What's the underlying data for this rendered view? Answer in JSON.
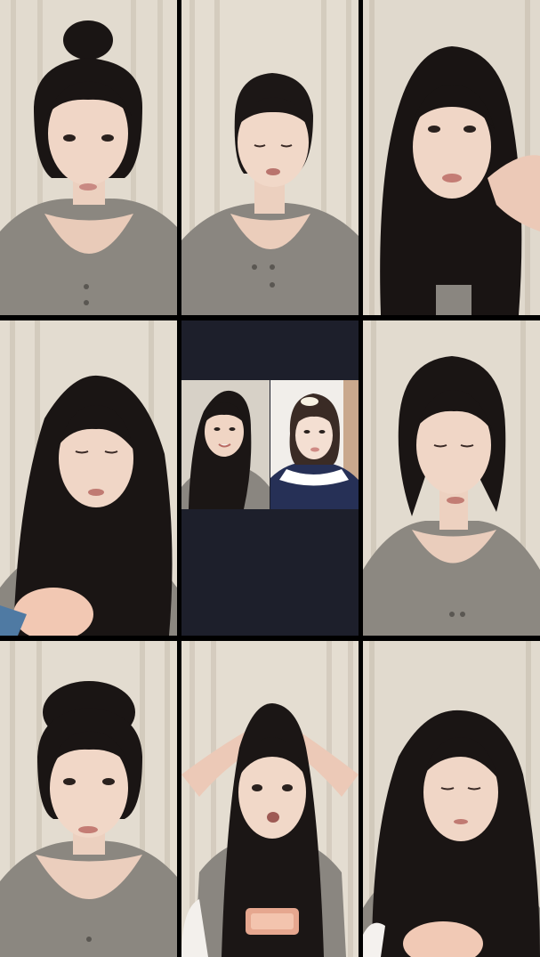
{
  "screen": {
    "background": "#000000",
    "call_panel_background": "#1d1f2b"
  },
  "tiles": [
    {
      "name": "video-tile-1",
      "pose": "hair-bun-looking-forward"
    },
    {
      "name": "video-tile-2",
      "pose": "hair-up-eyes-closed"
    },
    {
      "name": "video-tile-3",
      "pose": "long-hair-hand-on-face"
    },
    {
      "name": "video-tile-4",
      "pose": "long-hair-looking-down"
    },
    {
      "name": "video-tile-6",
      "pose": "ponytail-looking-down"
    },
    {
      "name": "video-tile-7",
      "pose": "hair-up-looking-forward"
    },
    {
      "name": "video-tile-8",
      "pose": "hands-on-head"
    },
    {
      "name": "video-tile-9",
      "pose": "long-hair-eyes-closed"
    }
  ],
  "call": {
    "participants": [
      {
        "name": "call-participant-left",
        "outfit": "gray-top"
      },
      {
        "name": "call-participant-right",
        "outfit": "white-collar-navy"
      }
    ]
  }
}
